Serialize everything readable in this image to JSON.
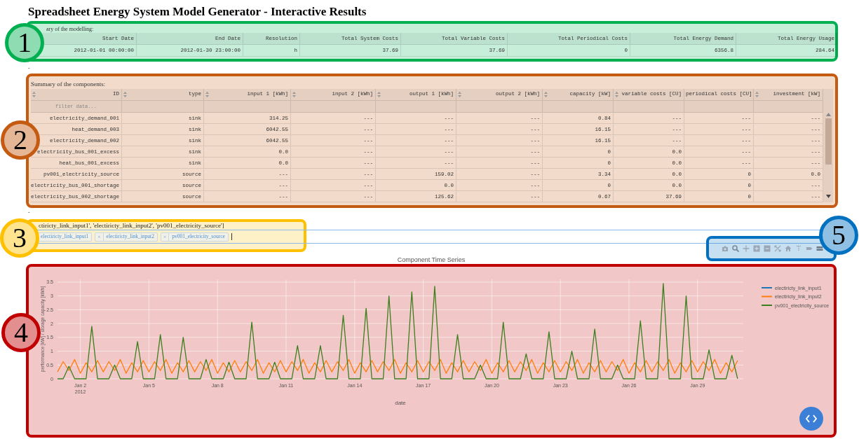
{
  "title": "Spreadsheet Energy System Model Generator - Interactive Results",
  "modelling_summary": {
    "callout": {
      "label": "1",
      "color": "#00b050"
    },
    "caption": "ary of the modelling:",
    "columns": [
      "Start Date",
      "End Date",
      "Resolution",
      "Total System Costs",
      "Total Variable Costs",
      "Total Periodical Costs",
      "Total Energy Demand",
      "Total Energy Usage"
    ],
    "rows": [
      [
        "2012-01-01 00:00:00",
        "2012-01-30 23:00:00",
        "h",
        "37.69",
        "37.69",
        "0",
        "6356.8",
        "284.64"
      ]
    ]
  },
  "spacer_marks": [
    "-",
    "-"
  ],
  "components_summary": {
    "callout": {
      "label": "2",
      "color": "#c55a11"
    },
    "caption": "Summary of the components:",
    "columns": [
      "ID",
      "type",
      "input 1 [kWh]",
      "input 2 [kWh]",
      "output 1 [kWh]",
      "output 2 [kWh]",
      "capacity [kW]",
      "variable costs [CU]",
      "periodical costs [CU]",
      "investment [kW]"
    ],
    "filter_placeholder": "filter data...",
    "rows": [
      [
        "electricity_demand_001",
        "sink",
        "314.25",
        "---",
        "---",
        "---",
        "0.84",
        "---",
        "---",
        "---"
      ],
      [
        "heat_demand_003",
        "sink",
        "6042.55",
        "---",
        "---",
        "---",
        "16.15",
        "---",
        "---",
        "---"
      ],
      [
        "electricity_demand_002",
        "sink",
        "6042.55",
        "---",
        "---",
        "---",
        "16.15",
        "---",
        "---",
        "---"
      ],
      [
        "electricity_bus_001_excess",
        "sink",
        "0.0",
        "---",
        "---",
        "---",
        "0",
        "0.0",
        "---",
        "---"
      ],
      [
        "heat_bus_001_excess",
        "sink",
        "0.0",
        "---",
        "---",
        "---",
        "0",
        "0.0",
        "---",
        "---"
      ],
      [
        "pv001_electricity_source",
        "source",
        "---",
        "---",
        "159.02",
        "---",
        "3.34",
        "0.0",
        "0",
        "0.0"
      ],
      [
        "electricity_bus_001_shortage",
        "source",
        "---",
        "---",
        "0.0",
        "---",
        "0",
        "0.0",
        "0",
        "---"
      ],
      [
        "electricity_bus_002_shortage",
        "source",
        "---",
        "---",
        "125.62",
        "---",
        "0.67",
        "37.69",
        "0",
        "---"
      ]
    ]
  },
  "component_selector": {
    "callout": {
      "label": "3",
      "color": "#ffc000"
    },
    "selected_text": "ctiricty_link_input1', 'electiricty_link_input2', 'pv001_electricity_source']",
    "tags": [
      {
        "label": "electiricty_link_input1"
      },
      {
        "label": "electiricty_link_input2",
        "remove": "×"
      },
      {
        "label": "pv001_electricity_source",
        "remove": "×"
      }
    ]
  },
  "plot_toolbar": {
    "callout": {
      "label": "5",
      "color": "#0070c0"
    }
  },
  "time_series": {
    "callout": {
      "label": "4",
      "color": "#c00000"
    },
    "chart_data": {
      "type": "line",
      "title": "Component Time Series",
      "xlabel": "date",
      "ylabel": "performance [kW] / storage capacity [kWh]",
      "x": [
        "2012-01-01T00:00",
        "2012-01-01T06:00",
        "2012-01-01T12:00",
        "2012-01-01T18:00",
        "2012-01-02T00:00",
        "2012-01-02T06:00",
        "2012-01-02T12:00",
        "2012-01-02T18:00",
        "2012-01-03T00:00",
        "2012-01-03T06:00",
        "2012-01-03T12:00",
        "2012-01-03T18:00",
        "2012-01-04T00:00",
        "2012-01-04T06:00",
        "2012-01-04T12:00",
        "2012-01-04T18:00",
        "2012-01-05T00:00",
        "2012-01-05T06:00",
        "2012-01-05T12:00",
        "2012-01-05T18:00",
        "2012-01-06T00:00",
        "2012-01-06T06:00",
        "2012-01-06T12:00",
        "2012-01-06T18:00",
        "2012-01-07T00:00",
        "2012-01-07T06:00",
        "2012-01-07T12:00",
        "2012-01-07T18:00",
        "2012-01-08T00:00",
        "2012-01-08T06:00",
        "2012-01-08T12:00",
        "2012-01-08T18:00",
        "2012-01-09T00:00",
        "2012-01-09T06:00",
        "2012-01-09T12:00",
        "2012-01-09T18:00",
        "2012-01-10T00:00",
        "2012-01-10T06:00",
        "2012-01-10T12:00",
        "2012-01-10T18:00",
        "2012-01-11T00:00",
        "2012-01-11T06:00",
        "2012-01-11T12:00",
        "2012-01-11T18:00",
        "2012-01-12T00:00",
        "2012-01-12T06:00",
        "2012-01-12T12:00",
        "2012-01-12T18:00",
        "2012-01-13T00:00",
        "2012-01-13T06:00",
        "2012-01-13T12:00",
        "2012-01-13T18:00",
        "2012-01-14T00:00",
        "2012-01-14T06:00",
        "2012-01-14T12:00",
        "2012-01-14T18:00",
        "2012-01-15T00:00",
        "2012-01-15T06:00",
        "2012-01-15T12:00",
        "2012-01-15T18:00",
        "2012-01-16T00:00",
        "2012-01-16T06:00",
        "2012-01-16T12:00",
        "2012-01-16T18:00",
        "2012-01-17T00:00",
        "2012-01-17T06:00",
        "2012-01-17T12:00",
        "2012-01-17T18:00",
        "2012-01-18T00:00",
        "2012-01-18T06:00",
        "2012-01-18T12:00",
        "2012-01-18T18:00",
        "2012-01-19T00:00",
        "2012-01-19T06:00",
        "2012-01-19T12:00",
        "2012-01-19T18:00",
        "2012-01-20T00:00",
        "2012-01-20T06:00",
        "2012-01-20T12:00",
        "2012-01-20T18:00",
        "2012-01-21T00:00",
        "2012-01-21T06:00",
        "2012-01-21T12:00",
        "2012-01-21T18:00",
        "2012-01-22T00:00",
        "2012-01-22T06:00",
        "2012-01-22T12:00",
        "2012-01-22T18:00",
        "2012-01-23T00:00",
        "2012-01-23T06:00",
        "2012-01-23T12:00",
        "2012-01-23T18:00",
        "2012-01-24T00:00",
        "2012-01-24T06:00",
        "2012-01-24T12:00",
        "2012-01-24T18:00",
        "2012-01-25T00:00",
        "2012-01-25T06:00",
        "2012-01-25T12:00",
        "2012-01-25T18:00",
        "2012-01-26T00:00",
        "2012-01-26T06:00",
        "2012-01-26T12:00",
        "2012-01-26T18:00",
        "2012-01-27T00:00",
        "2012-01-27T06:00",
        "2012-01-27T12:00",
        "2012-01-27T18:00",
        "2012-01-28T00:00",
        "2012-01-28T06:00",
        "2012-01-28T12:00",
        "2012-01-28T18:00",
        "2012-01-29T00:00",
        "2012-01-29T06:00",
        "2012-01-29T12:00",
        "2012-01-29T18:00",
        "2012-01-30T00:00",
        "2012-01-30T06:00",
        "2012-01-30T12:00",
        "2012-01-30T18:00"
      ],
      "series": [
        {
          "name": "electiricty_link_input1",
          "color": "#1f77b4",
          "values": [
            null,
            null,
            null,
            null,
            null,
            null,
            null,
            null,
            null,
            null,
            null,
            null,
            null,
            null,
            null,
            null,
            null,
            null,
            null,
            null,
            null,
            null,
            null,
            null,
            null,
            null,
            null,
            null,
            null,
            null,
            null,
            null,
            null,
            null,
            null,
            null,
            null,
            null,
            null,
            null,
            null,
            null,
            null,
            null,
            null,
            null,
            null,
            null,
            null,
            null,
            null,
            null,
            null,
            null,
            null,
            null,
            null,
            null,
            null,
            null,
            null,
            null,
            null,
            null,
            null,
            null,
            null,
            null,
            null,
            null,
            null,
            null,
            null,
            null,
            null,
            null,
            null,
            null,
            null,
            null,
            null,
            null,
            null,
            null,
            null,
            null,
            null,
            null,
            null,
            null,
            null,
            null,
            null,
            null,
            null,
            null,
            null,
            null,
            null,
            null,
            null,
            null,
            null,
            null,
            null,
            null,
            null,
            null,
            null,
            null,
            null,
            null,
            null,
            null,
            null,
            null,
            null,
            null,
            null,
            null
          ]
        },
        {
          "name": "electiricty_link_input2",
          "color": "#ff7f0e",
          "values": [
            0.25,
            0.62,
            0.3,
            0.7,
            0.2,
            0.58,
            0.25,
            0.66,
            0.25,
            0.62,
            0.3,
            0.7,
            0.2,
            0.58,
            0.25,
            0.66,
            0.25,
            0.62,
            0.3,
            0.7,
            0.2,
            0.58,
            0.25,
            0.66,
            0.25,
            0.62,
            0.3,
            0.7,
            0.2,
            0.58,
            0.25,
            0.66,
            0.25,
            0.62,
            0.3,
            0.7,
            0.2,
            0.58,
            0.25,
            0.66,
            0.25,
            0.62,
            0.3,
            0.7,
            0.2,
            0.58,
            0.25,
            0.66,
            0.25,
            0.62,
            0.3,
            0.7,
            0.2,
            0.58,
            0.25,
            0.66,
            0.25,
            0.62,
            0.3,
            0.7,
            0.2,
            0.58,
            0.25,
            0.66,
            0.25,
            0.62,
            0.3,
            0.7,
            0.2,
            0.58,
            0.25,
            0.66,
            0.25,
            0.62,
            0.3,
            0.7,
            0.2,
            0.58,
            0.25,
            0.66,
            0.25,
            0.62,
            0.3,
            0.7,
            0.2,
            0.58,
            0.25,
            0.66,
            0.25,
            0.62,
            0.3,
            0.7,
            0.2,
            0.58,
            0.25,
            0.66,
            0.25,
            0.62,
            0.3,
            0.7,
            0.2,
            0.58,
            0.25,
            0.66,
            0.25,
            0.62,
            0.3,
            0.7,
            0.2,
            0.58,
            0.25,
            0.66,
            0.25,
            0.62,
            0.3,
            0.7,
            0.2,
            0.58,
            0.25,
            0.66
          ]
        },
        {
          "name": "pv001_electricity_source",
          "color": "#3d7f1e",
          "values": [
            0,
            0,
            0.45,
            0,
            0,
            0,
            1.9,
            0,
            0,
            0,
            0.5,
            0,
            0,
            0,
            1.35,
            0,
            0,
            0,
            1.6,
            0,
            0,
            0,
            1.5,
            0,
            0,
            0,
            0.7,
            0,
            0,
            0,
            0.6,
            0,
            0,
            0,
            2.05,
            0,
            0,
            0,
            0.6,
            0,
            0,
            0,
            1.2,
            0,
            0,
            0,
            1.2,
            0,
            0,
            0,
            2.3,
            0,
            0,
            0,
            2.55,
            0,
            0,
            0,
            3,
            0,
            0,
            0,
            3.15,
            0,
            0,
            0,
            3.35,
            0,
            0,
            0,
            1.6,
            0,
            0,
            0,
            0.5,
            0,
            0,
            0,
            2.05,
            0,
            0,
            0,
            0.9,
            0,
            0,
            0,
            1.7,
            0,
            0,
            0,
            1,
            0,
            0,
            0,
            1.8,
            0,
            0,
            0,
            0.5,
            0,
            0,
            0,
            2.1,
            0,
            0,
            0,
            3.45,
            0,
            0,
            0,
            3,
            0,
            0,
            0,
            1.05,
            0,
            0,
            0,
            0.85,
            0
          ]
        }
      ],
      "xlim": [
        "2012-01-01T00:00",
        "2012-01-31T00:00"
      ],
      "ylim": [
        0,
        3.6
      ],
      "xticks": [
        {
          "value": "2012-01-02T00:00",
          "label": "Jan 2\n2012"
        },
        {
          "value": "2012-01-05T00:00",
          "label": "Jan 5"
        },
        {
          "value": "2012-01-08T00:00",
          "label": "Jan 8"
        },
        {
          "value": "2012-01-11T00:00",
          "label": "Jan 11"
        },
        {
          "value": "2012-01-14T00:00",
          "label": "Jan 14"
        },
        {
          "value": "2012-01-17T00:00",
          "label": "Jan 17"
        },
        {
          "value": "2012-01-20T00:00",
          "label": "Jan 20"
        },
        {
          "value": "2012-01-23T00:00",
          "label": "Jan 23"
        },
        {
          "value": "2012-01-26T00:00",
          "label": "Jan 26"
        },
        {
          "value": "2012-01-29T00:00",
          "label": "Jan 29"
        }
      ],
      "yticks": [
        0,
        0.5,
        1,
        1.5,
        2,
        2.5,
        3,
        3.5
      ],
      "grid": true,
      "legend": "right"
    }
  }
}
